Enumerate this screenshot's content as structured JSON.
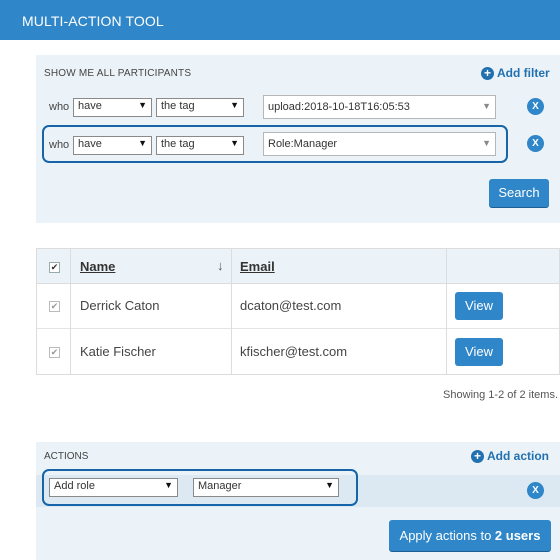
{
  "window": {
    "title": "MULTI-ACTION TOOL"
  },
  "filters": {
    "heading": "SHOW ME ALL PARTICIPANTS",
    "add_label": "Add filter",
    "rows": [
      {
        "who": "who",
        "verb": "have",
        "type": "the tag",
        "value": "upload:2018-10-18T16:05:53",
        "remove": "X"
      },
      {
        "who": "who",
        "verb": "have",
        "type": "the tag",
        "value": "Role:Manager",
        "remove": "X"
      }
    ],
    "search_label": "Search"
  },
  "table": {
    "columns": [
      "Name",
      "Email"
    ],
    "sort_icon": "↓",
    "rows": [
      {
        "name": "Derrick Caton",
        "email": "dcaton@test.com",
        "action": "View"
      },
      {
        "name": "Katie Fischer",
        "email": "kfischer@test.com",
        "action": "View"
      }
    ],
    "showing": "Showing 1-2 of 2 items."
  },
  "actions": {
    "heading": "ACTIONS",
    "add_label": "Add action",
    "row": {
      "action": "Add role",
      "value": "Manager",
      "remove": "X"
    },
    "apply_prefix": "Apply actions to ",
    "apply_count": "2 users"
  },
  "colors": {
    "accent": "#2f86c8",
    "panel": "#ecf3f8",
    "highlight": "#1565a8"
  }
}
